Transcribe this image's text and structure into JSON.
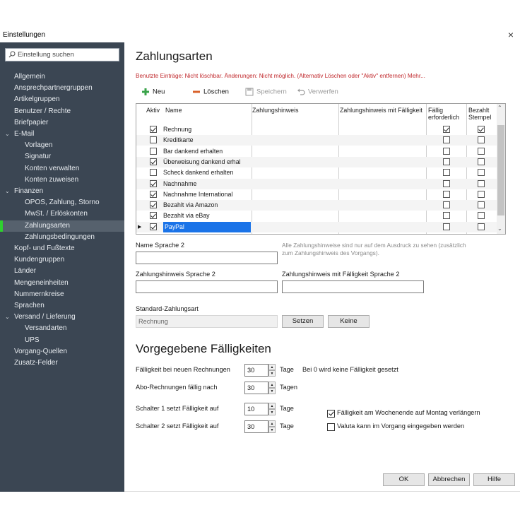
{
  "window": {
    "title": "Einstellungen",
    "close": "×"
  },
  "sidebar": {
    "search_placeholder": "Einstellung suchen",
    "items": [
      {
        "label": "Allgemein",
        "indent": 0
      },
      {
        "label": "Ansprechpartnergruppen",
        "indent": 0
      },
      {
        "label": "Artikelgruppen",
        "indent": 0
      },
      {
        "label": "Benutzer / Rechte",
        "indent": 0
      },
      {
        "label": "Briefpapier",
        "indent": 0
      },
      {
        "label": "E-Mail",
        "indent": 0,
        "expanded": true
      },
      {
        "label": "Vorlagen",
        "indent": 1
      },
      {
        "label": "Signatur",
        "indent": 1
      },
      {
        "label": "Konten verwalten",
        "indent": 1
      },
      {
        "label": "Konten zuweisen",
        "indent": 1
      },
      {
        "label": "Finanzen",
        "indent": 0,
        "expanded": true
      },
      {
        "label": "OPOS, Zahlung, Storno",
        "indent": 1
      },
      {
        "label": "MwSt. / Erlöskonten",
        "indent": 1
      },
      {
        "label": "Zahlungsarten",
        "indent": 1,
        "selected": true
      },
      {
        "label": "Zahlungsbedingungen",
        "indent": 1
      },
      {
        "label": "Kopf- und Fußtexte",
        "indent": 0
      },
      {
        "label": "Kundengruppen",
        "indent": 0
      },
      {
        "label": "Länder",
        "indent": 0
      },
      {
        "label": "Mengeneinheiten",
        "indent": 0
      },
      {
        "label": "Nummernkreise",
        "indent": 0
      },
      {
        "label": "Sprachen",
        "indent": 0
      },
      {
        "label": "Versand / Lieferung",
        "indent": 0,
        "expanded": true
      },
      {
        "label": "Versandarten",
        "indent": 1
      },
      {
        "label": "UPS",
        "indent": 1
      },
      {
        "label": "Vorgang-Quellen",
        "indent": 0
      },
      {
        "label": "Zusatz-Felder",
        "indent": 0
      }
    ]
  },
  "main": {
    "title": "Zahlungsarten",
    "notice": "Benutzte Einträge: Nicht löschbar. Änderungen: Nicht möglich. (Alternativ Löschen oder \"Aktiv\" entfernen) Mehr...",
    "toolbar": {
      "new": "Neu",
      "delete": "Löschen",
      "save": "Speichern",
      "discard": "Verwerfen"
    },
    "grid": {
      "columns": [
        "Aktiv",
        "Name",
        "Zahlungshinweis",
        "Zahlungshinweis mit Fälligkeit",
        "Fällig erforderlich",
        "Bezahlt Stempel"
      ],
      "rows": [
        {
          "aktiv": true,
          "name": "Rechnung",
          "faellig": true,
          "stempel": true
        },
        {
          "aktiv": false,
          "name": "Kreditkarte",
          "faellig": false,
          "stempel": false
        },
        {
          "aktiv": false,
          "name": "Bar dankend erhalten",
          "faellig": false,
          "stempel": false
        },
        {
          "aktiv": true,
          "name": "Überweisung dankend erhal",
          "faellig": false,
          "stempel": false
        },
        {
          "aktiv": false,
          "name": "Scheck dankend erhalten",
          "faellig": false,
          "stempel": false
        },
        {
          "aktiv": true,
          "name": "Nachnahme",
          "faellig": false,
          "stempel": false
        },
        {
          "aktiv": true,
          "name": "Nachnahme International",
          "faellig": false,
          "stempel": false
        },
        {
          "aktiv": true,
          "name": "Bezahlt via Amazon",
          "faellig": false,
          "stempel": false
        },
        {
          "aktiv": true,
          "name": "Bezahlt via eBay",
          "faellig": false,
          "stempel": false
        },
        {
          "aktiv": true,
          "name": "PayPal",
          "faellig": false,
          "stempel": false,
          "selected": true
        }
      ]
    },
    "form": {
      "name_lang2": "Name Sprache 2",
      "hint_text": "Alle Zahlungshinweise sind nur auf dem Ausdruck zu sehen (zusätzlich zum Zahlungshinweis des Vorgangs).",
      "hint_lang2": "Zahlungshinweis Sprache 2",
      "hint_due_lang2": "Zahlungshinweis mit Fälligkeit Sprache 2",
      "std_label": "Standard-Zahlungsart",
      "std_value": "Rechnung",
      "set_btn": "Setzen",
      "none_btn": "Keine"
    },
    "due": {
      "title": "Vorgegebene Fälligkeiten",
      "rows": [
        {
          "label": "Fälligkeit bei neuen Rechnungen",
          "value": "30",
          "unit": "Tage",
          "note": "Bei 0 wird keine Fälligkeit gesetzt"
        },
        {
          "label": "Abo-Rechnungen fällig nach",
          "value": "30",
          "unit": "Tagen",
          "note": ""
        },
        {
          "label": "Schalter 1 setzt Fälligkeit auf",
          "value": "10",
          "unit": "Tage",
          "note": ""
        },
        {
          "label": "Schalter 2 setzt Fälligkeit auf",
          "value": "30",
          "unit": "Tage",
          "note": ""
        }
      ],
      "weekend": {
        "label": "Fälligkeit am Wochenende auf Montag verlängern",
        "checked": true
      },
      "valuta": {
        "label": "Valuta kann im Vorgang eingegeben werden",
        "checked": false
      }
    },
    "footer": {
      "ok": "OK",
      "cancel": "Abbrechen",
      "help": "Hilfe"
    }
  }
}
